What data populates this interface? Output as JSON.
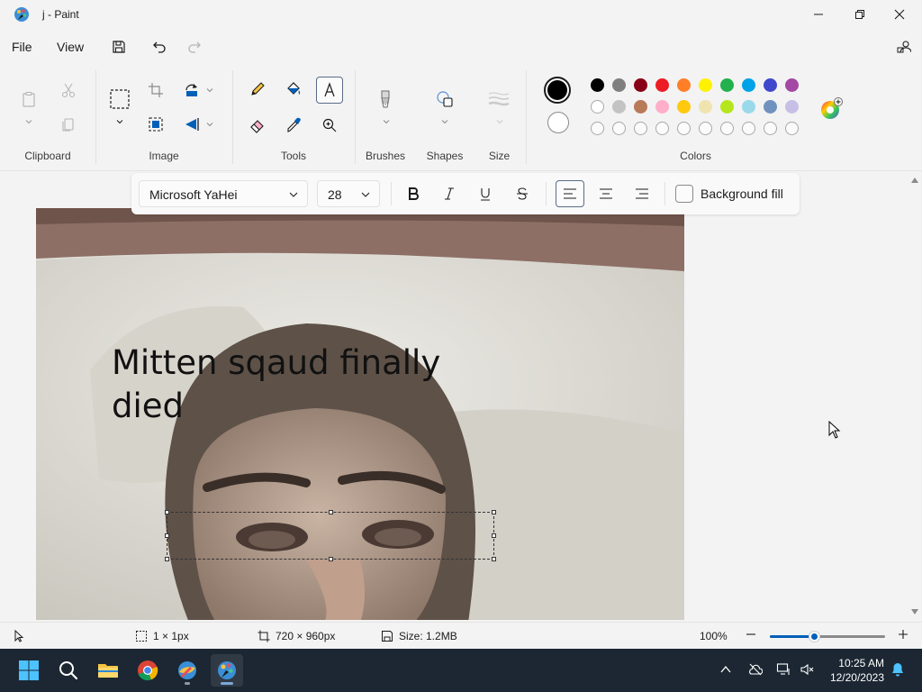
{
  "window": {
    "title": "j - Paint"
  },
  "menu": {
    "file": "File",
    "view": "View"
  },
  "ribbon": {
    "groups": {
      "clipboard": "Clipboard",
      "image": "Image",
      "tools": "Tools",
      "brushes": "Brushes",
      "shapes": "Shapes",
      "size": "Size",
      "colors": "Colors"
    },
    "colors": {
      "primary": "#000000",
      "secondary": "#ffffff",
      "palette_row1": [
        "#000000",
        "#7f7f7f",
        "#880015",
        "#ed1c24",
        "#ff7f27",
        "#fff200",
        "#22b14c",
        "#00a2e8",
        "#3f48cc",
        "#a349a4"
      ],
      "palette_row2": [
        "#ffffff",
        "#c3c3c3",
        "#b97a57",
        "#ffaec9",
        "#ffc90e",
        "#efe4b0",
        "#b5e61d",
        "#99d9ea",
        "#7092be",
        "#c8bfe7"
      ]
    }
  },
  "textbar": {
    "font": "Microsoft YaHei",
    "size": "28",
    "background_fill_label": "Background fill"
  },
  "canvas": {
    "text_line1": "Mitten sqaud finally",
    "text_line2": "died"
  },
  "status": {
    "selection_size": "1 × 1px",
    "canvas_size": "720 × 960px",
    "file_size": "Size: 1.2MB",
    "zoom": "100%",
    "zoom_level": 0.38
  },
  "taskbar": {
    "time": "10:25 AM",
    "date": "12/20/2023"
  }
}
